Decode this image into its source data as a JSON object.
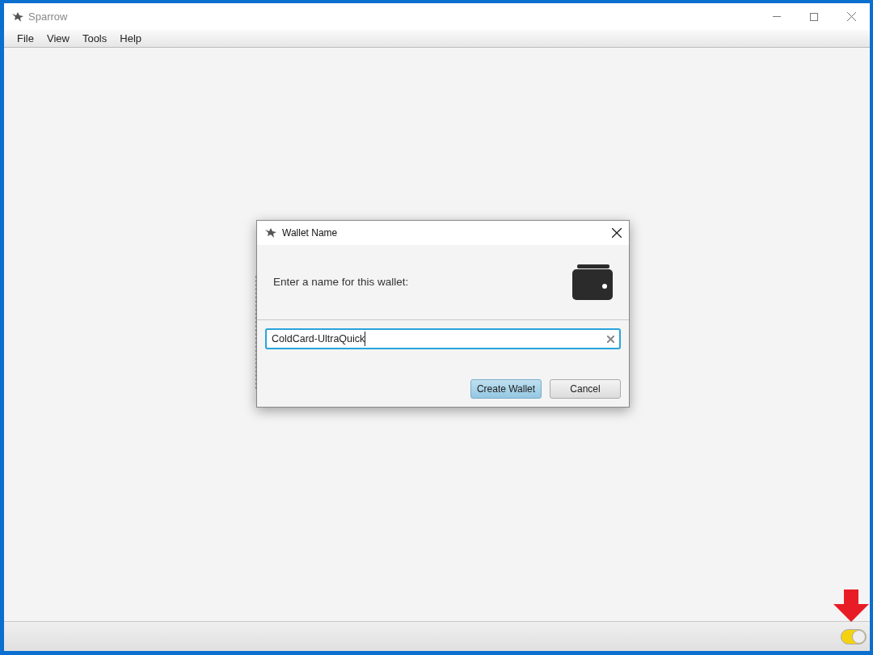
{
  "window": {
    "title": "Sparrow"
  },
  "menu": [
    "File",
    "View",
    "Tools",
    "Help"
  ],
  "dialog": {
    "title": "Wallet Name",
    "prompt": "Enter a name for this wallet:",
    "field": {
      "value": "ColdCard-UltraQuick"
    },
    "buttons": [
      {
        "label": "Create Wallet",
        "kind": "default"
      },
      {
        "label": "Cancel",
        "kind": "normal"
      }
    ]
  },
  "status_bar": {
    "toggle": {
      "on": true
    }
  }
}
